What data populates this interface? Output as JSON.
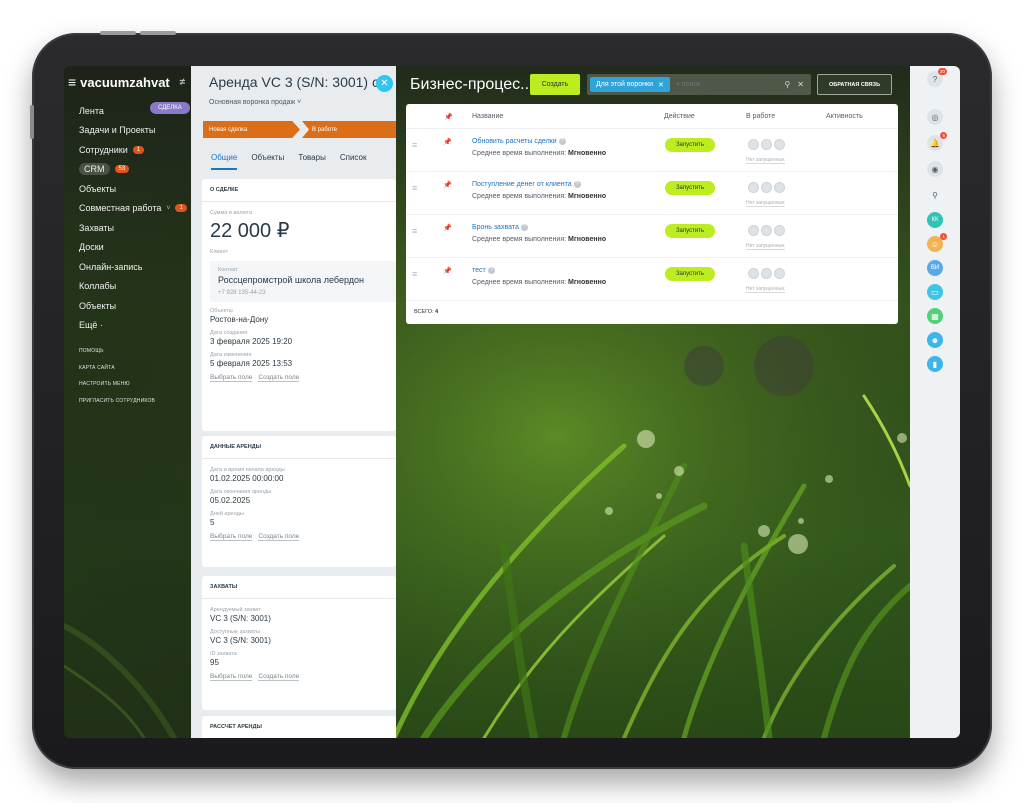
{
  "brand": {
    "name": "vacuumzahvat"
  },
  "nav": {
    "items": [
      {
        "label": "Лента"
      },
      {
        "label": "Задачи и Проекты"
      },
      {
        "label": "Сотрудники",
        "badge": "1"
      },
      {
        "label": "CRM",
        "badge": "53"
      },
      {
        "label": "Объекты"
      },
      {
        "label": "Совместная работа",
        "badge": "1"
      },
      {
        "label": "Захваты"
      },
      {
        "label": "Доски"
      },
      {
        "label": "Онлайн-запись"
      },
      {
        "label": "Коллабы"
      },
      {
        "label": "Объекты"
      },
      {
        "label": "Ещё ·"
      }
    ],
    "deal_pill": "СДЕЛКА",
    "footer": [
      "ПОМОЩЬ",
      "КАРТА САЙТА",
      "НАСТРОИТЬ МЕНЮ",
      "ПРИГЛАСИТЬ СОТРУДНИКОВ"
    ]
  },
  "deal": {
    "title": "Аренда VC 3 (S/N: 3001) с 0",
    "funnel": "Основная воронка продаж ˅",
    "stages": [
      "Новая сделка",
      "В работе"
    ],
    "tabs": [
      "Общие",
      "Объекты",
      "Товары",
      "Список"
    ],
    "about": {
      "head": "О СДЕЛКЕ",
      "amount_label": "Сумма и валюта",
      "amount": "22 000 ₽",
      "client_label": "Клиент",
      "contact_label": "Контакт",
      "contact_name": "Россцепромстрой школа лебердон",
      "contact_phone": "+7 928 135-44-23",
      "object_label": "Объекты",
      "object_value": "Ростов-на-Дону",
      "created_label": "Дата создания",
      "created_value": "3 февраля 2025 19:20",
      "changed_label": "Дата изменения",
      "changed_value": "5 февраля 2025 13:53",
      "link_choose": "Выбрать поле",
      "link_create": "Создать поле"
    },
    "rent": {
      "head": "ДАННЫЕ АРЕНДЫ",
      "start_label": "Дата и время начала аренды",
      "start_value": "01.02.2025 00:00:00",
      "end_label": "Дата окончания аренды",
      "end_value": "05.02.2025",
      "days_label": "Дней аренды",
      "days_value": "5",
      "link_choose": "Выбрать поле",
      "link_create": "Создать поле"
    },
    "captures": {
      "head": "ЗАХВАТЫ",
      "rented_label": "Арендуемый захват",
      "rented_value": "VC 3 (S/N: 3001)",
      "available_label": "Доступные захваты",
      "available_value": "VC 3 (S/N: 3001)",
      "id_label": "ID захвата",
      "id_value": "95",
      "link_choose": "Выбрать поле",
      "link_create": "Создать поле"
    },
    "calc": {
      "head": "РАССЧЕТ АРЕНДЫ"
    }
  },
  "slider": {
    "title": "Бизнес-процес...",
    "create": "Создать",
    "filter_tag": "Для этой воронки",
    "search_placeholder": "+ поиск",
    "feedback": "ОБРАТНАЯ СВЯЗЬ"
  },
  "table": {
    "columns": {
      "name": "Название",
      "action": "Действие",
      "in_work": "В работе",
      "activity": "Активность"
    },
    "rows": [
      {
        "name": "Обновить расчеты сделки",
        "avg_label": "Среднее время выполнения:",
        "avg_value": "Мгновенно",
        "run": "Запустить",
        "not_run": "Нет запущенных"
      },
      {
        "name": "Поступление денег от клиента",
        "avg_label": "Среднее время выполнения:",
        "avg_value": "Мгновенно",
        "run": "Запустить",
        "not_run": "Нет запущенных"
      },
      {
        "name": "Бронь захвата",
        "avg_label": "Среднее время выполнения:",
        "avg_value": "Мгновенно",
        "run": "Запустить",
        "not_run": "Нет запущенных"
      },
      {
        "name": "тест",
        "avg_label": "Среднее время выполнения:",
        "avg_value": "Мгновенно",
        "run": "Запустить",
        "not_run": "Нет запущенных"
      }
    ],
    "total_label": "ВСЕГО:",
    "total_value": "4"
  },
  "rightbar": {
    "help_badge": "20",
    "notify_badge": "5",
    "avatar1": "КК",
    "avatar2_badge": "1",
    "avatar3": "ВИ"
  },
  "colors": {
    "accent_green": "#bbed21",
    "stage_orange": "#db6e18",
    "link_blue": "#1b74c4",
    "close_blue": "#2fc6f6"
  }
}
